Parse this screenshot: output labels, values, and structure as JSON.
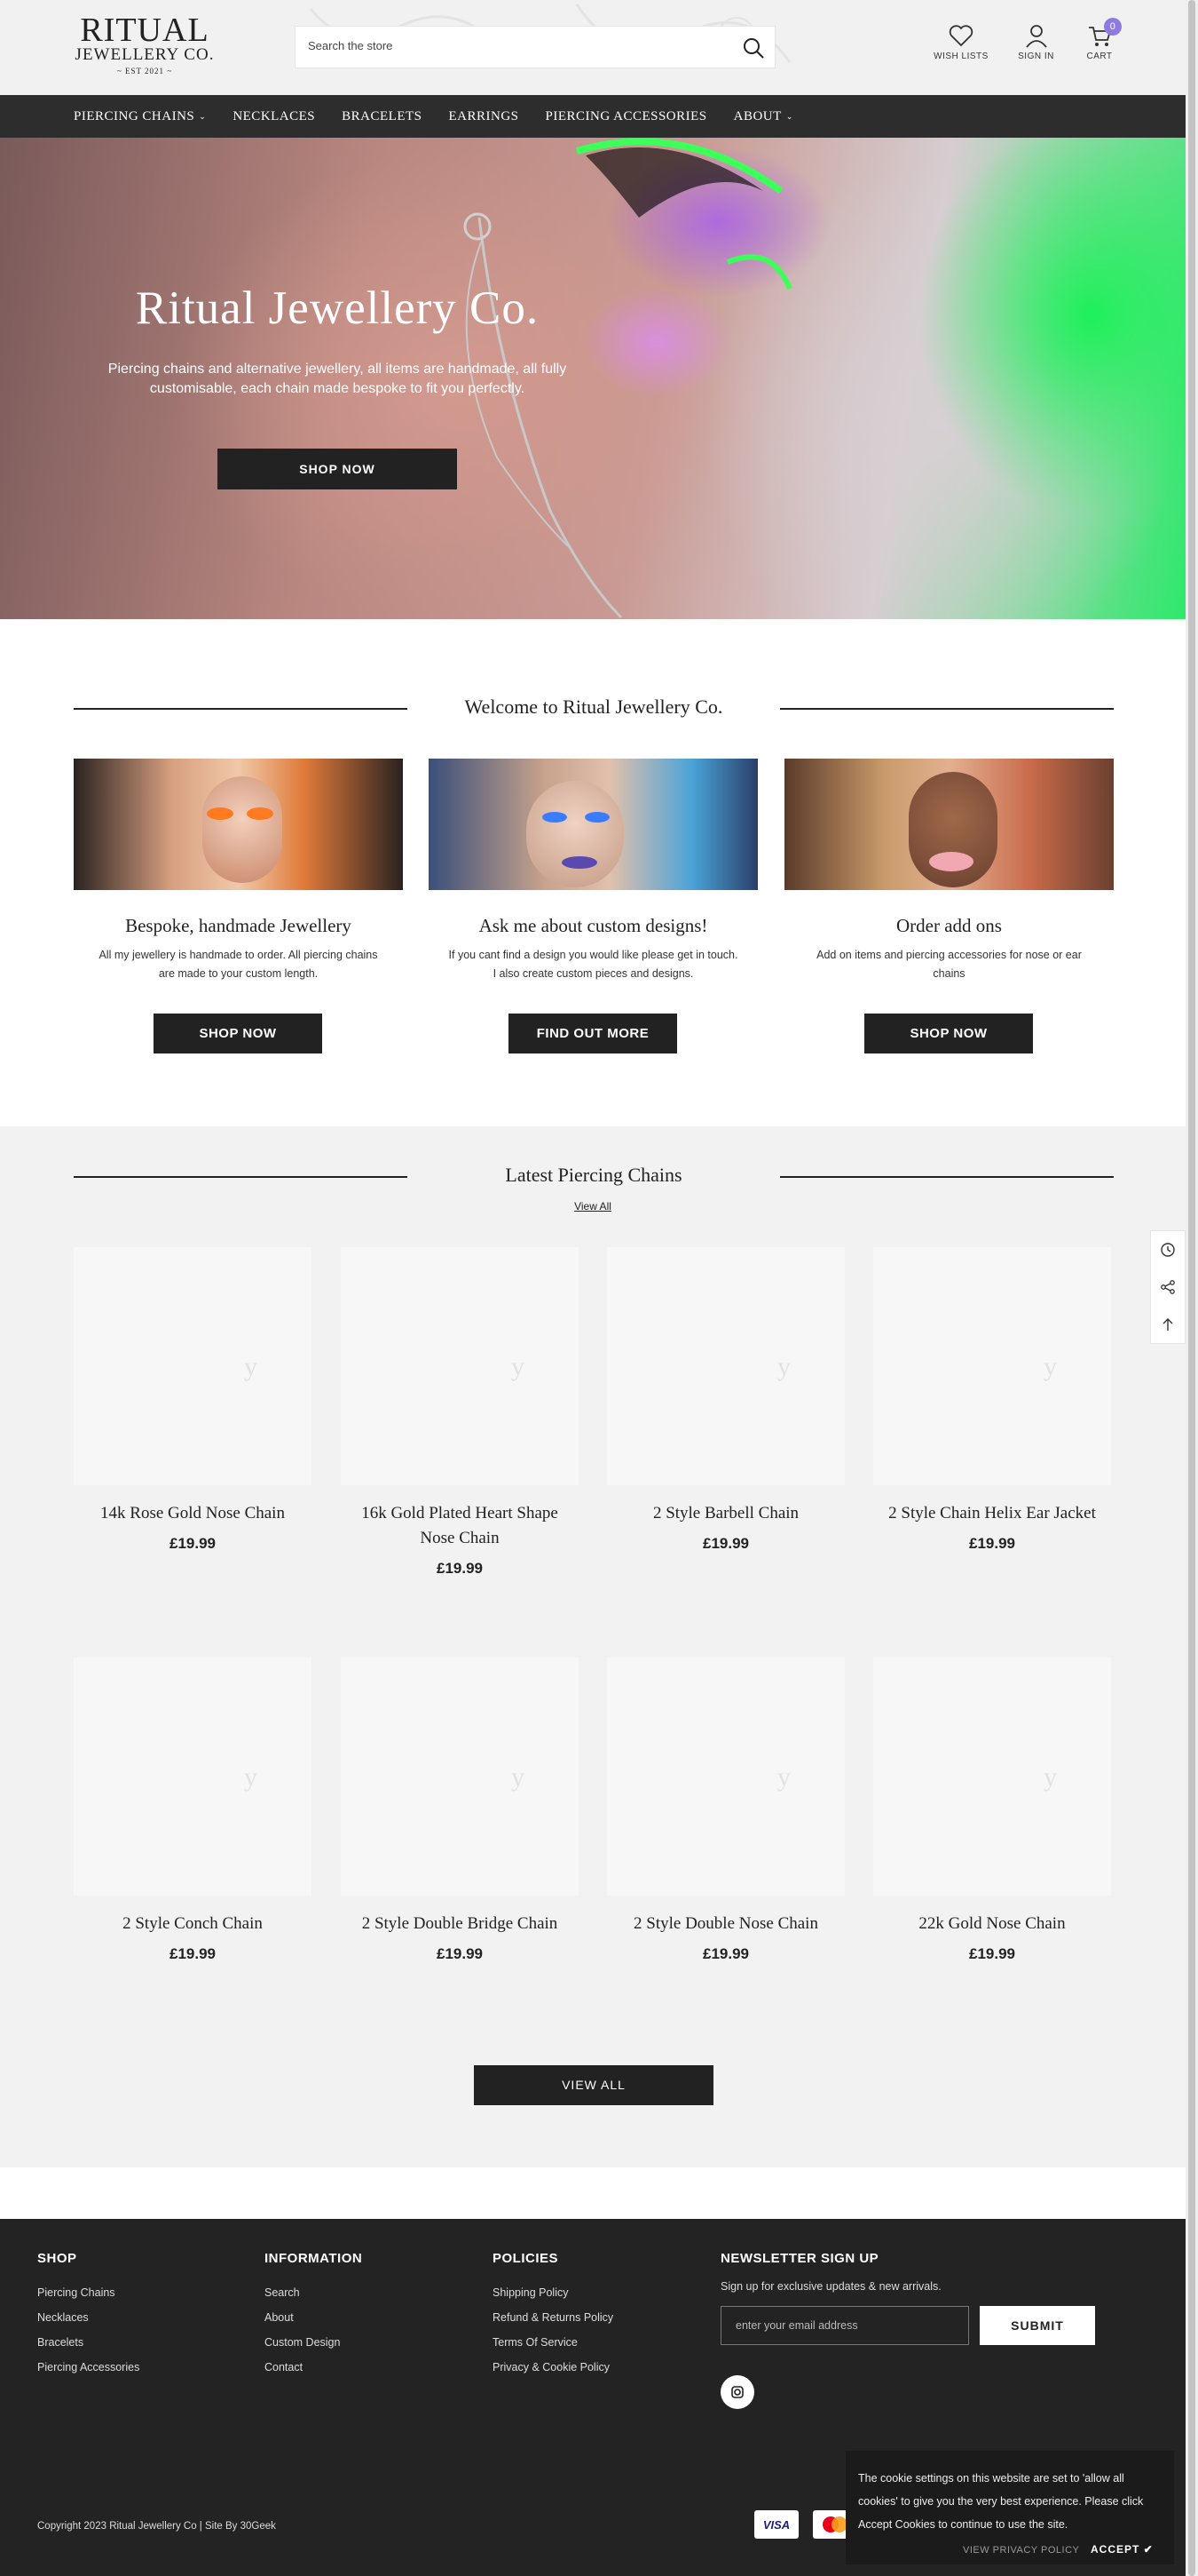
{
  "header": {
    "logo": {
      "line1": "RITUAL",
      "line2": "JEWELLERY CO.",
      "line3": "~ EST 2021 ~"
    },
    "search_placeholder": "Search the store",
    "wishlist_label": "WISH LISTS",
    "signin_label": "SIGN IN",
    "cart_label": "CART",
    "cart_count": "0"
  },
  "nav": {
    "items": [
      {
        "label": "PIERCING CHAINS",
        "has_dropdown": true
      },
      {
        "label": "NECKLACES",
        "has_dropdown": false
      },
      {
        "label": "BRACELETS",
        "has_dropdown": false
      },
      {
        "label": "EARRINGS",
        "has_dropdown": false
      },
      {
        "label": "PIERCING ACCESSORIES",
        "has_dropdown": false
      },
      {
        "label": "ABOUT",
        "has_dropdown": true
      }
    ]
  },
  "hero": {
    "title": "Ritual Jewellery Co.",
    "subtitle": "Piercing chains and alternative jewellery, all items are handmade, all fully customisable, each chain made bespoke to fit you perfectly.",
    "button": "SHOP NOW"
  },
  "welcome": {
    "title": "Welcome to Ritual Jewellery Co.",
    "features": [
      {
        "title": "Bespoke, handmade Jewellery",
        "text": "All my jewellery is handmade to order. All piercing chains are made to your custom length.",
        "button": "SHOP NOW"
      },
      {
        "title": "Ask me about custom designs!",
        "text": "If you cant find a design you would like please get in touch. I also create custom pieces and designs.",
        "button": "FIND OUT MORE"
      },
      {
        "title": "Order add ons",
        "text": "Add on items and piercing accessories for nose or ear chains",
        "button": "SHOP NOW"
      }
    ]
  },
  "latest": {
    "title": "Latest Piercing Chains",
    "view_all_link": "View All",
    "products": [
      {
        "name": "14k Rose Gold Nose Chain",
        "price": "£19.99"
      },
      {
        "name": "16k Gold Plated Heart Shape Nose Chain",
        "price": "£19.99"
      },
      {
        "name": "2 Style Barbell Chain",
        "price": "£19.99"
      },
      {
        "name": "2 Style Chain Helix Ear Jacket",
        "price": "£19.99"
      },
      {
        "name": "2 Style Conch Chain",
        "price": "£19.99"
      },
      {
        "name": "2 Style Double Bridge Chain",
        "price": "£19.99"
      },
      {
        "name": "2 Style Double Nose Chain",
        "price": "£19.99"
      },
      {
        "name": "22k Gold Nose Chain",
        "price": "£19.99"
      }
    ],
    "placeholder_glyph": "y",
    "view_all_button": "VIEW ALL"
  },
  "footer": {
    "shop": {
      "title": "SHOP",
      "links": [
        "Piercing Chains",
        "Necklaces",
        "Bracelets",
        "Piercing Accessories"
      ]
    },
    "information": {
      "title": "INFORMATION",
      "links": [
        "Search",
        "About",
        "Custom Design",
        "Contact"
      ]
    },
    "policies": {
      "title": "POLICIES",
      "links": [
        "Shipping Policy",
        "Refund & Returns Policy",
        "Terms Of Service",
        "Privacy & Cookie Policy"
      ]
    },
    "newsletter": {
      "title": "NEWSLETTER SIGN UP",
      "text": "Sign up for exclusive updates & new arrivals.",
      "placeholder": "enter your email address",
      "button": "SUBMIT"
    },
    "copyright": "Copyright 2023 Ritual Jewellery Co | Site By 30Geek",
    "payment": [
      "VISA",
      "mastercard",
      "card",
      "card",
      "card",
      "card"
    ]
  },
  "cookie": {
    "text": "The cookie settings on this website are set to 'allow all cookies' to give you the very best experience. Please click Accept Cookies to continue to use the site.",
    "policy_link": "VIEW PRIVACY POLICY",
    "accept": "ACCEPT ✔"
  },
  "colors": {
    "accent": "#8e7be0",
    "dark": "#222222",
    "nav_bg": "#2d2d2d",
    "footer_bg": "#232323"
  }
}
